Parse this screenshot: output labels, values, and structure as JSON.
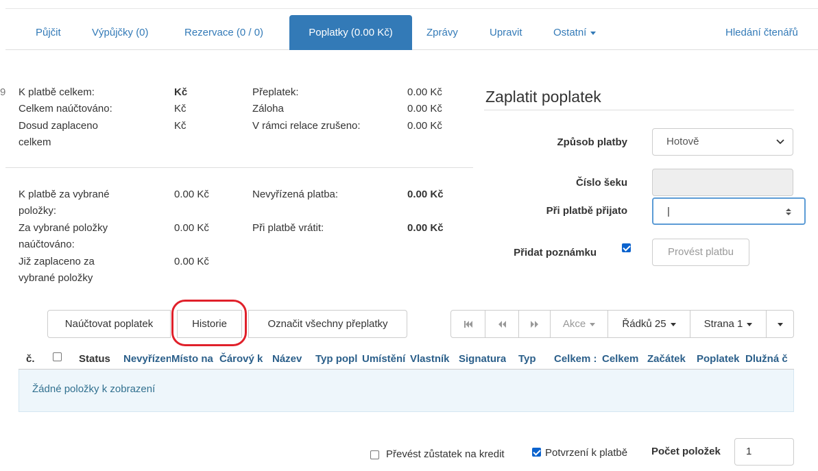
{
  "tabs": [
    {
      "label": "Půjčit"
    },
    {
      "label": "Výpůjčky (0)"
    },
    {
      "label": "Rezervace (0 / 0)"
    },
    {
      "label": "Poplatky (0.00 Kč)"
    },
    {
      "label": "Zprávy"
    },
    {
      "label": "Upravit"
    },
    {
      "label": "Ostatní"
    },
    {
      "label": "Hledání čtenářů"
    }
  ],
  "summary": {
    "total_due_label": "K platbě celkem:",
    "total_due_value": "Kč",
    "total_billed_label": "Celkem naúčtováno:",
    "total_billed_value": "Kč",
    "paid_to_date_label": "Dosud zaplaceno celkem",
    "paid_to_date_value": "Kč",
    "overpayment_label": "Přeplatek:",
    "overpayment_value": "0.00 Kč",
    "deposit_label": "Záloha",
    "deposit_value": "0.00 Kč",
    "session_cancelled_label": "V rámci relace zrušeno:",
    "session_cancelled_value": "0.00 Kč"
  },
  "selected": {
    "due_label": "K platbě za vybrané položky:",
    "due_value": "0.00 Kč",
    "billed_label": "Za vybrané položky naúčtováno:",
    "billed_value": "0.00 Kč",
    "paid_label": "Již zaplaceno za vybrané položky",
    "paid_value": "0.00 Kč",
    "pending_label": "Nevyřízená platba:",
    "pending_value": "0.00 Kč",
    "refund_label": "Při platbě vrátit:",
    "refund_value": "0.00 Kč"
  },
  "payment": {
    "title": "Zaplatit poplatek",
    "method_label": "Způsob platby",
    "method_value": "Hotově",
    "check_label": "Číslo šeku",
    "received_label": "Při platbě přijato",
    "received_value": "|",
    "note_label": "Přidat poznámku",
    "submit_label": "Provést platbu"
  },
  "toolbar": {
    "bill_label": "Naúčtovat poplatek",
    "history_label": "Historie",
    "mark_overpaid_label": "Označit všechny přeplatky",
    "actions_label": "Akce",
    "rows_label": "Řádků 25",
    "page_label": "Strana 1"
  },
  "table": {
    "columns": [
      "č.",
      "Status",
      "Nevyřízená",
      "Místo na",
      "Čárový k",
      "Název",
      "Typ popl",
      "Umístění",
      "Vlastník",
      "Signatura",
      "Typ",
      "Celkem :",
      "Celkem",
      "Začátek",
      "Poplatek",
      "Dlužná č"
    ],
    "empty_text": "Žádné položky k zobrazení"
  },
  "footer": {
    "transfer_label": "Převést zůstatek na kredit",
    "confirm_label": "Potvrzení k platbě",
    "count_label": "Počet položek",
    "count_value": "1"
  },
  "colors": {
    "primary": "#337ab7",
    "highlight_ring": "#e0202a",
    "empty_row_bg": "#eef6fb"
  }
}
